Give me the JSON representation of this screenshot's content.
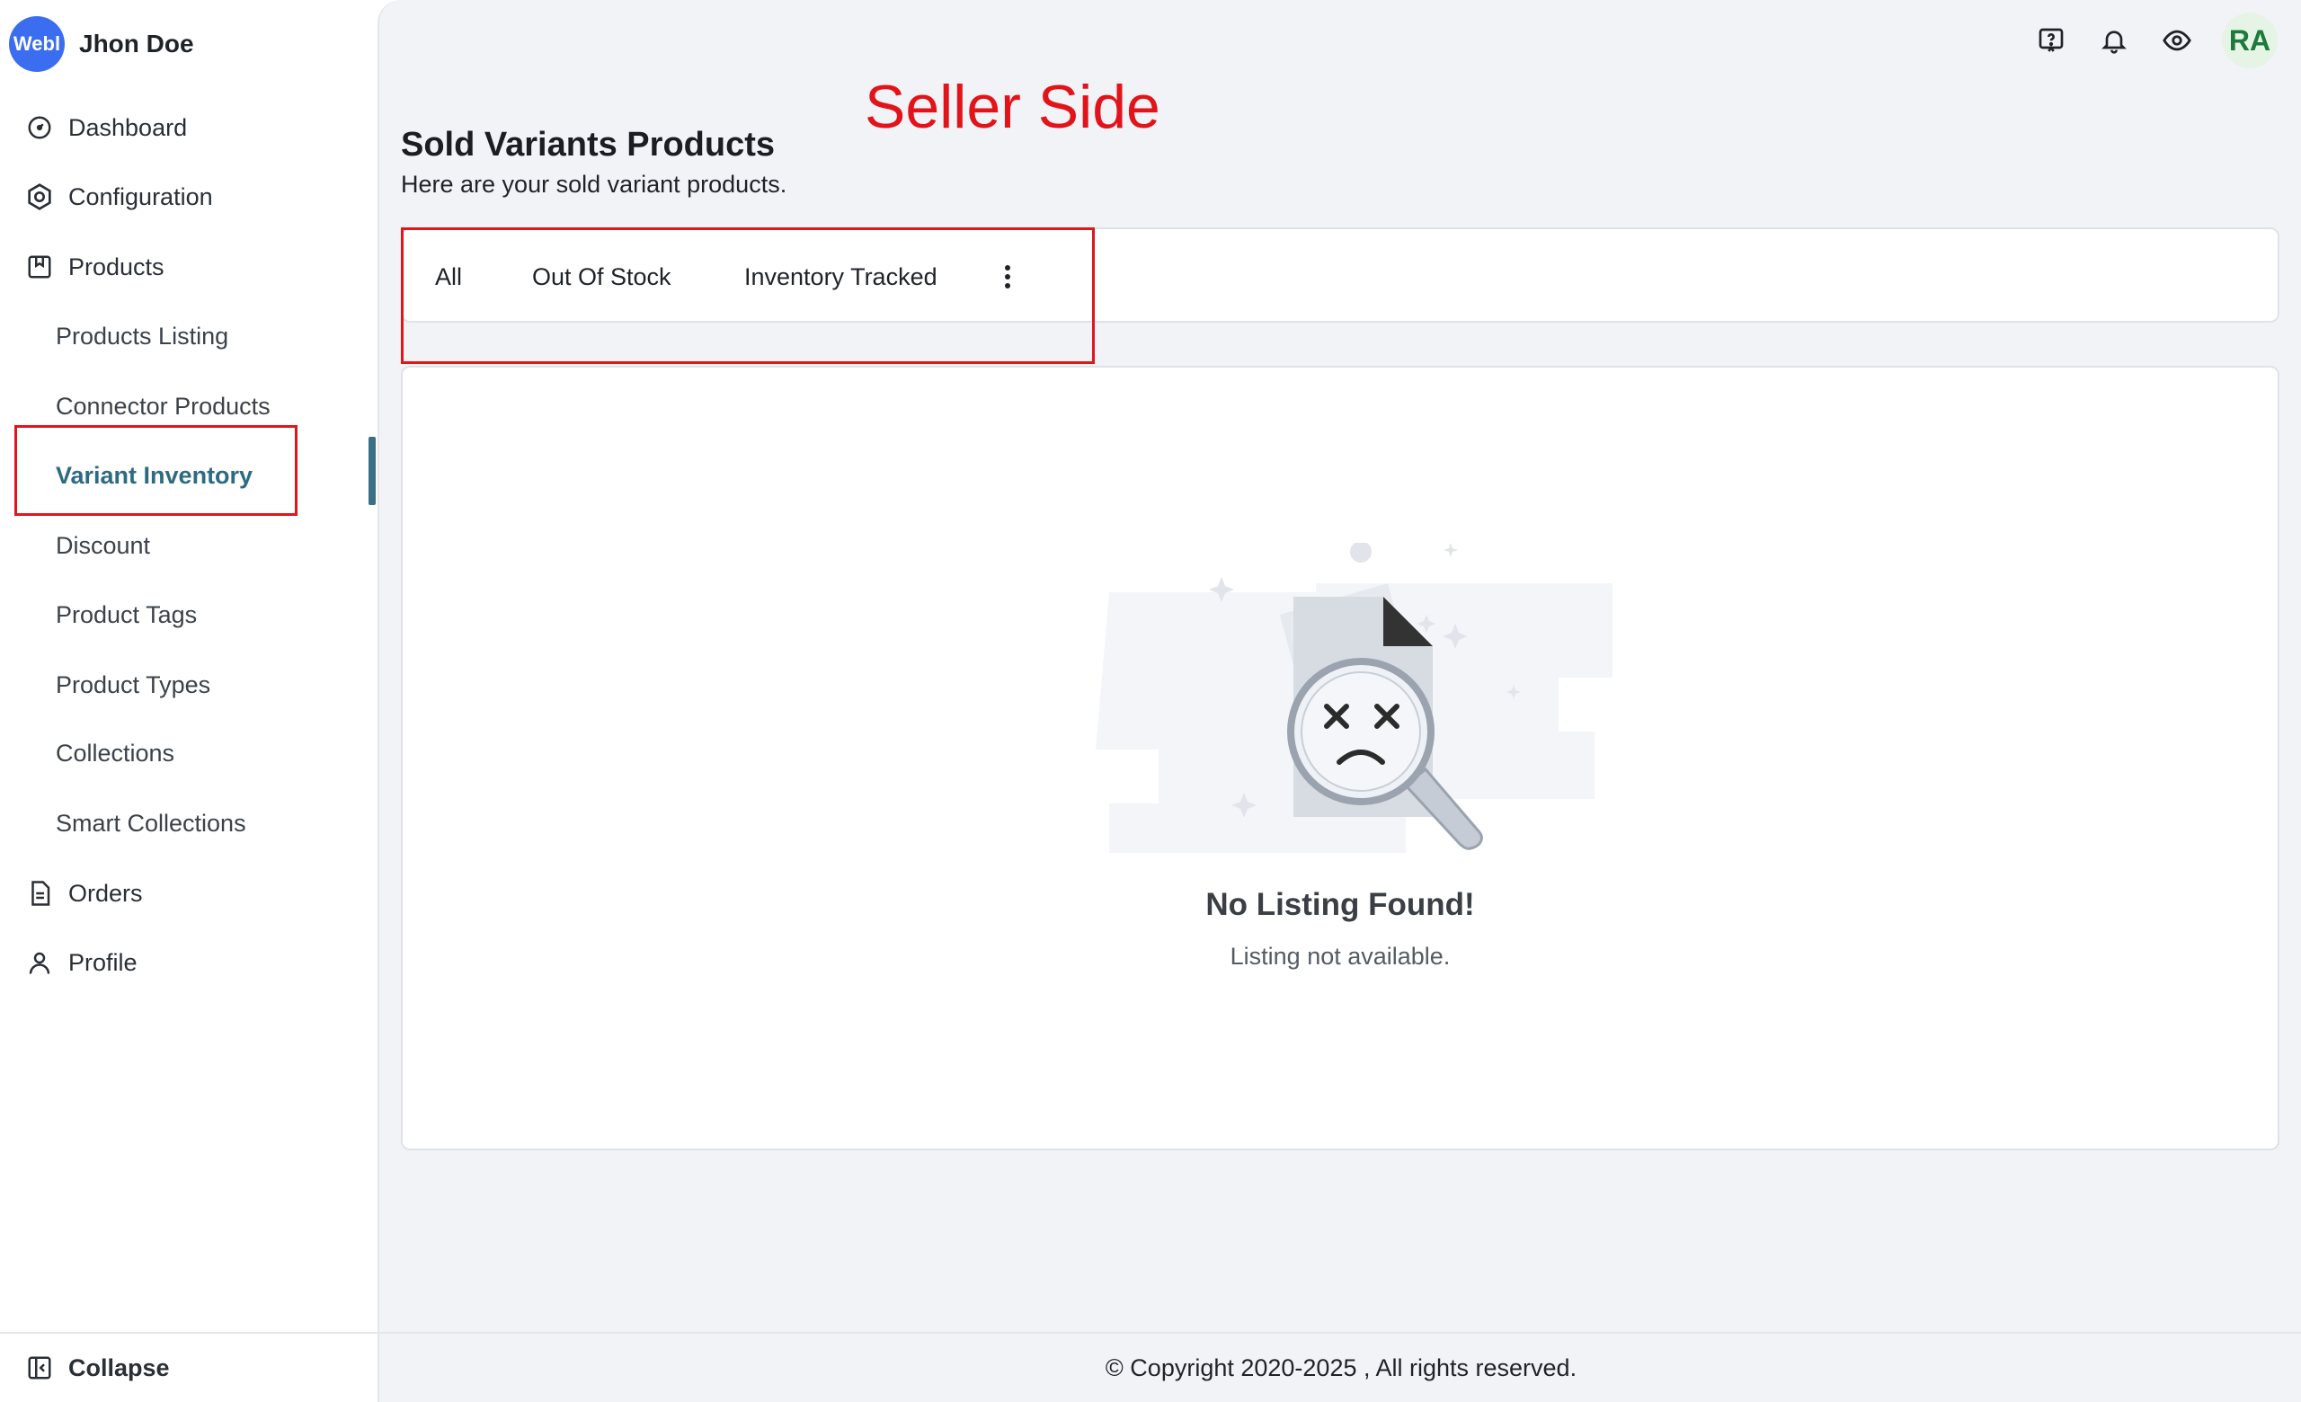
{
  "brand": {
    "logo_text": "Webl",
    "user_name": "Jhon Doe"
  },
  "sidebar": {
    "items": [
      {
        "label": "Dashboard",
        "icon": "dashboard-icon"
      },
      {
        "label": "Configuration",
        "icon": "hexagon-settings-icon"
      },
      {
        "label": "Products",
        "icon": "products-icon"
      },
      {
        "label": "Products Listing"
      },
      {
        "label": "Connector Products"
      },
      {
        "label": "Variant Inventory",
        "active": true
      },
      {
        "label": "Discount"
      },
      {
        "label": "Product Tags"
      },
      {
        "label": "Product Types"
      },
      {
        "label": "Collections"
      },
      {
        "label": "Smart Collections"
      },
      {
        "label": "Orders",
        "icon": "orders-icon"
      },
      {
        "label": "Profile",
        "icon": "user-icon"
      }
    ],
    "collapse_label": "Collapse"
  },
  "topbar": {
    "icons": [
      "help-icon",
      "bell-icon",
      "eye-icon"
    ],
    "avatar_initials": "RA"
  },
  "annotation": "Seller Side",
  "page": {
    "title": "Sold Variants Products",
    "subtitle": "Here are your sold variant products."
  },
  "tabs": [
    "All",
    "Out Of Stock",
    "Inventory Tracked"
  ],
  "empty_state": {
    "title": "No Listing Found!",
    "text": "Listing not available."
  },
  "footer": "© Copyright 2020-2025 , All rights reserved.",
  "colors": {
    "accent": "#2e6b80",
    "annotation": "#e3131a",
    "brand": "#3a6df0",
    "background": "#f1f3f7"
  }
}
